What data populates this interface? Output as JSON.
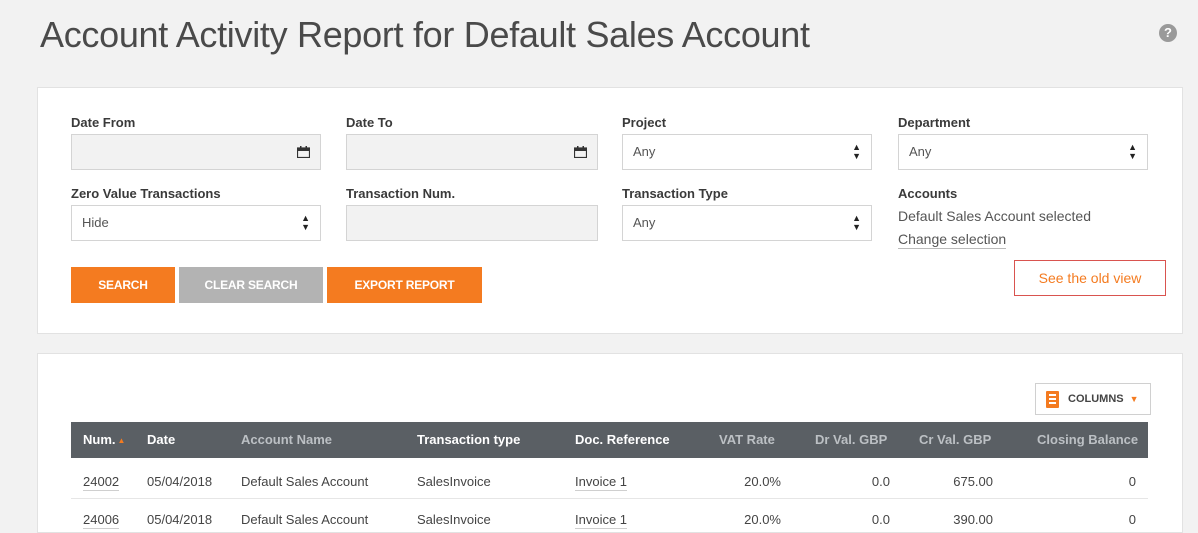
{
  "page": {
    "title": "Account Activity Report for Default Sales Account",
    "help_icon": "?"
  },
  "filters": {
    "date_from": {
      "label": "Date From",
      "value": "",
      "icon": "calendar-icon"
    },
    "date_to": {
      "label": "Date To",
      "value": "",
      "icon": "calendar-icon"
    },
    "project": {
      "label": "Project",
      "value": "Any"
    },
    "department": {
      "label": "Department",
      "value": "Any"
    },
    "zero_value": {
      "label": "Zero Value Transactions",
      "value": "Hide"
    },
    "transaction_num": {
      "label": "Transaction Num.",
      "value": ""
    },
    "transaction_type": {
      "label": "Transaction Type",
      "value": "Any"
    },
    "accounts": {
      "label": "Accounts",
      "selected_text": "Default Sales Account selected",
      "change_link": "Change selection"
    }
  },
  "buttons": {
    "search": "SEARCH",
    "clear": "CLEAR SEARCH",
    "export": "EXPORT REPORT",
    "old_view": "See the old view"
  },
  "table": {
    "columns_button": "COLUMNS",
    "headers": [
      "Num.",
      "Date",
      "Account Name",
      "Transaction type",
      "Doc. Reference",
      "VAT Rate",
      "Dr Val. GBP",
      "Cr Val. GBP",
      "Closing Balance"
    ],
    "rows": [
      [
        "24002",
        "05/04/2018",
        "Default Sales Account",
        "SalesInvoice",
        "Invoice 1",
        "20.0%",
        "0.0",
        "675.00",
        "0"
      ],
      [
        "24006",
        "05/04/2018",
        "Default Sales Account",
        "SalesInvoice",
        "Invoice 1",
        "20.0%",
        "0.0",
        "390.00",
        "0"
      ]
    ]
  },
  "colors": {
    "accent": "#f47b20",
    "header_bg": "#5a5f64",
    "link_border": "#d9534f"
  }
}
